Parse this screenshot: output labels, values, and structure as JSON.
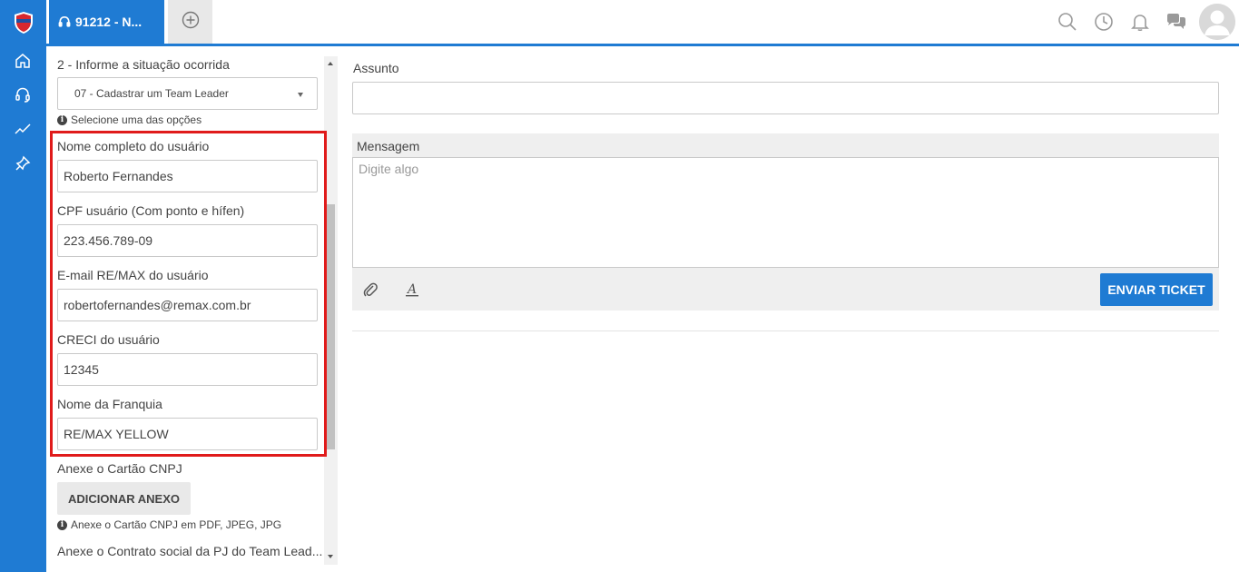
{
  "rail": {
    "logo": "shield-logo",
    "items": [
      {
        "name": "home-icon"
      },
      {
        "name": "headset-icon"
      },
      {
        "name": "trend-icon"
      },
      {
        "name": "pin-icon"
      }
    ]
  },
  "tabs": {
    "active_label": "91212 - N...",
    "active_icon": "headset-icon",
    "add_icon": "plus-circle-icon"
  },
  "top_icons": [
    "search-icon",
    "clock-icon",
    "bell-icon",
    "chat-icon",
    "avatar"
  ],
  "form": {
    "situation_label": "2 - Informe a situação ocorrida",
    "situation_value": "07 - Cadastrar um Team Leader",
    "situation_hint": "Selecione uma das opções",
    "fields": [
      {
        "label": "Nome completo do usuário",
        "value": "Roberto Fernandes"
      },
      {
        "label": "CPF usuário (Com ponto e hífen)",
        "value": "223.456.789-09"
      },
      {
        "label": "E-mail RE/MAX do usuário",
        "value": "robertofernandes@remax.com.br"
      },
      {
        "label": "CRECI do usuário",
        "value": "12345"
      },
      {
        "label": "Nome da Franquia",
        "value": "RE/MAX YELLOW"
      }
    ],
    "attach_cnpj_label": "Anexe o Cartão CNPJ",
    "attach_button": "ADICIONAR ANEXO",
    "attach_cnpj_hint": "Anexe o Cartão CNPJ em PDF, JPEG, JPG",
    "attach_contract_label": "Anexe o Contrato social da PJ do Team Lead..."
  },
  "main": {
    "subject_label": "Assunto",
    "subject_value": "",
    "message_label": "Mensagem",
    "message_placeholder": "Digite algo",
    "send_button": "ENVIAR TICKET"
  }
}
